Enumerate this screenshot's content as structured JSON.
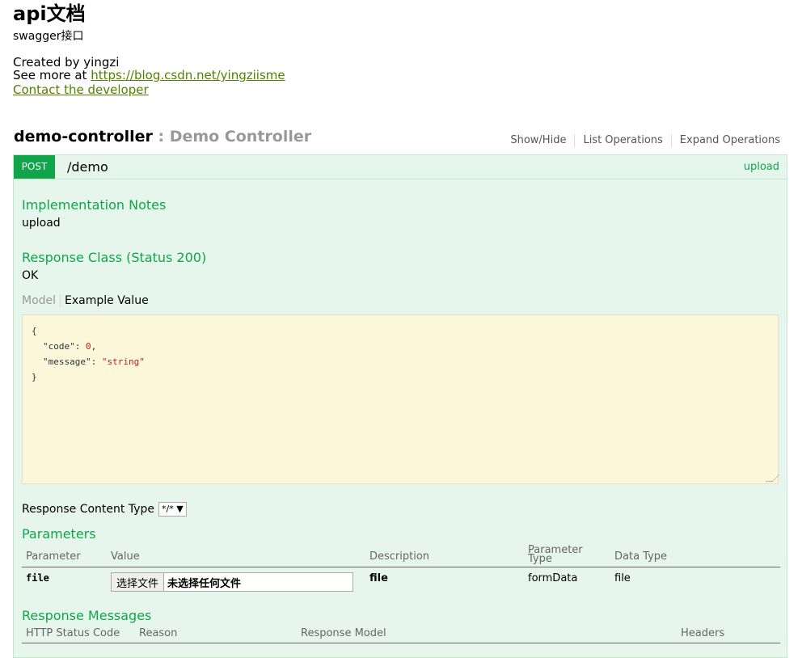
{
  "info": {
    "title": "api文档",
    "description": "swagger接口",
    "created_by": "Created by yingzi",
    "see_more_prefix": "See more at ",
    "see_more_link": "https://blog.csdn.net/yingziisme",
    "contact": "Contact the developer"
  },
  "resource": {
    "name": "demo-controller",
    "separator": " : ",
    "description": "Demo Controller",
    "actions": [
      "Show/Hide",
      "List Operations",
      "Expand Operations"
    ]
  },
  "operation": {
    "method": "POST",
    "path": "/demo",
    "summary": "upload",
    "implementation_notes_title": "Implementation Notes",
    "implementation_notes": "upload",
    "response_class_title": "Response Class (Status 200)",
    "response_class": "OK",
    "tab_model": "Model",
    "tab_example": "Example Value",
    "example": {
      "open": "{",
      "code_key": "\"code\"",
      "code_val": "0",
      "message_key": "\"message\"",
      "message_val": "\"string\"",
      "close": "}"
    },
    "response_content_type_label": "Response Content Type",
    "response_content_type_value": "*/*",
    "parameters_title": "Parameters",
    "param_headers": [
      "Parameter",
      "Value",
      "Description",
      "Parameter Type",
      "Data Type"
    ],
    "param_headers_type_line1": "Parameter",
    "param_headers_type_line2": "Type",
    "params": [
      {
        "name": "file",
        "file_button": "选择文件",
        "file_none": "未选择任何文件",
        "description": "file",
        "param_type": "formData",
        "data_type": "file"
      }
    ],
    "response_messages_title": "Response Messages",
    "response_headers": [
      "HTTP Status Code",
      "Reason",
      "Response Model",
      "Headers"
    ]
  },
  "colors": {
    "accent": "#10a54a",
    "panel_bg": "#e7f6ec",
    "example_bg": "#fcf6db",
    "link": "#547f00"
  }
}
